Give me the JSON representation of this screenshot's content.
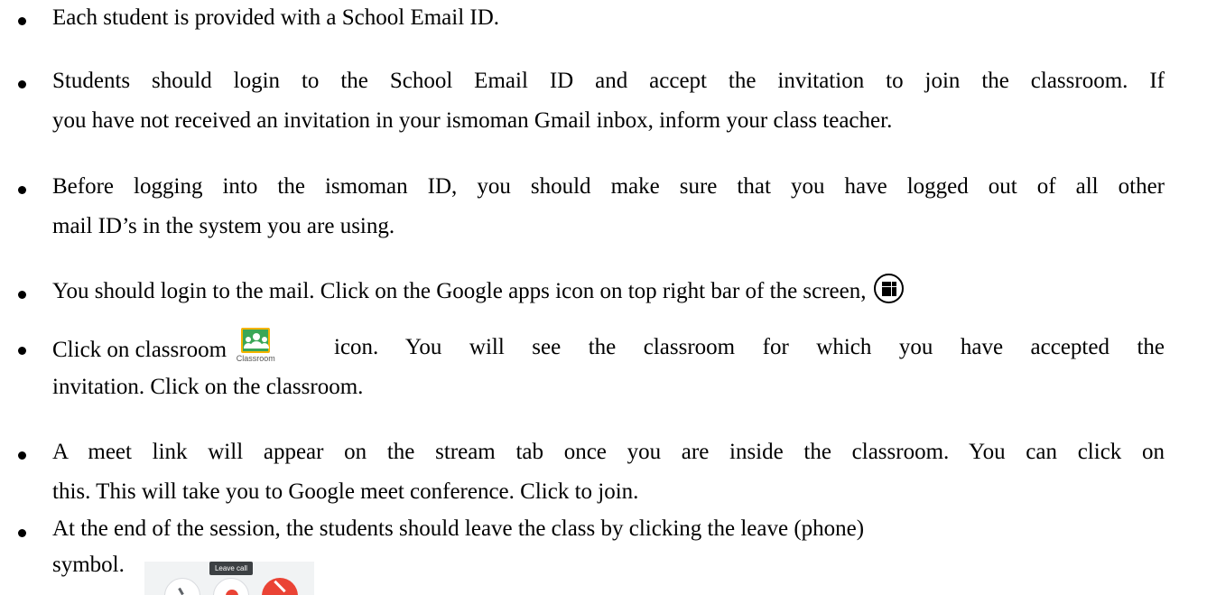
{
  "bullets": {
    "b1": "Each student is provided with a School Email ID.",
    "b2_line1": "Students should login to the School Email ID and accept the invitation to join the classroom. If",
    "b2_line2": "you have not received an invitation in your ismoman Gmail inbox, inform your class teacher.",
    "b3_line1": "Before logging into the ismoman ID, you should make sure that you have logged out of all other",
    "b3_line2": "mail ID’s in the system you are using.",
    "b4": "You should login to the mail. Click on the Google apps icon on top right bar of the screen,",
    "b5_pre": "Click on classroom",
    "b5_post": "icon. You will see the classroom for which you have accepted the",
    "b5_line2": "invitation. Click on the classroom.",
    "b6_line1": "A meet link will appear on the stream tab once you are inside the classroom. You can click on",
    "b6_line2": "this. This will take you to Google meet conference. Click to join.",
    "b7_line1": "At the end of the session, the students should leave the class by clicking the leave (phone)",
    "b7_line2": "symbol."
  },
  "icons": {
    "apps": "google-apps-icon",
    "classroom": "google-classroom-icon",
    "classroom_caption": "Classroom",
    "leave_call_tooltip": "Leave call"
  },
  "colors": {
    "classroom_green": "#3aa757",
    "classroom_yellow": "#f4b400",
    "leave_red": "#ea4335"
  }
}
